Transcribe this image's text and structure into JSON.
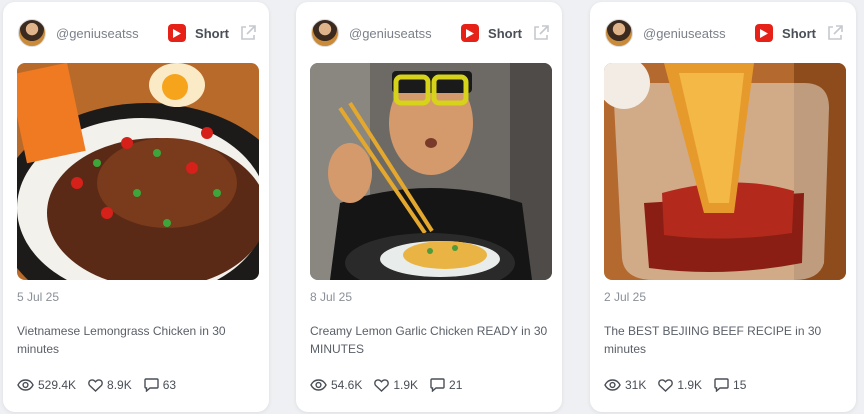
{
  "cards": [
    {
      "handle": "@geniuseatss",
      "type_label": "Short",
      "date": "5 Jul 25",
      "title": "Vietnamese Lemongrass Chicken in 30 minutes",
      "views": "529.4K",
      "likes": "8.9K",
      "comments": "63"
    },
    {
      "handle": "@geniuseatss",
      "type_label": "Short",
      "date": "8 Jul 25",
      "title": "Creamy Lemon Garlic Chicken READY in 30 MINUTES",
      "views": "54.6K",
      "likes": "1.9K",
      "comments": "21"
    },
    {
      "handle": "@geniuseatss",
      "type_label": "Short",
      "date": "2 Jul 25",
      "title": "The BEST BEJIING BEEF RECIPE in 30 minutes",
      "views": "31K",
      "likes": "1.9K",
      "comments": "15"
    }
  ],
  "icons": {
    "platform": "youtube-icon",
    "external": "external-link-icon",
    "views": "eye-icon",
    "likes": "heart-icon",
    "comments": "comment-icon"
  },
  "colors": {
    "youtube_red": "#e62117",
    "card_bg": "#ffffff",
    "page_bg": "#eef0f3"
  }
}
